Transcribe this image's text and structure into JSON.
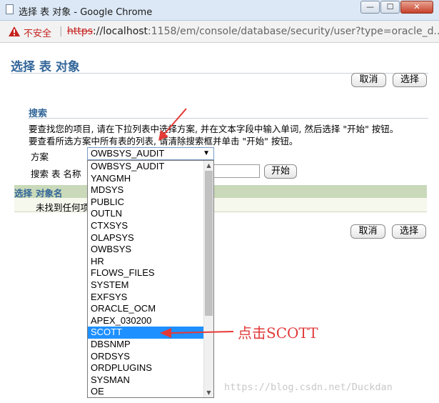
{
  "window": {
    "title": "选择 表 对象 - Google Chrome",
    "controls": {
      "minimize": "—",
      "maximize": "☐",
      "close": "✕"
    }
  },
  "address_bar": {
    "security_label": "不安全",
    "separator": "|",
    "url_scheme": "https",
    "url_host": "://localhost",
    "url_path": ":1158/em/console/database/security/user?type=oracle_d..."
  },
  "page": {
    "title": "选择 表 对象",
    "cancel_label": "取消",
    "select_label": "选择",
    "search": {
      "heading": "搜索",
      "instruction_1": "要查找您的项目, 请在下拉列表中选择方案, 并在文本字段中输入单词, 然后选择 \"开始\" 按钮。",
      "instruction_2": "要查看所选方案中所有表的列表, 请清除搜索框并单击 \"开始\" 按钮。",
      "schema_label": "方案",
      "schema_value": "OWBSYS_AUDIT",
      "search_label": "搜索 表 名称",
      "search_value": "",
      "go_label": "开始"
    },
    "table": {
      "columns": [
        "选择",
        "对象名"
      ],
      "empty_message": "未找到任何项"
    }
  },
  "dropdown": {
    "options": [
      "OWBSYS_AUDIT",
      "YANGMH",
      "MDSYS",
      "PUBLIC",
      "OUTLN",
      "CTXSYS",
      "OLAPSYS",
      "OWBSYS",
      "HR",
      "FLOWS_FILES",
      "SYSTEM",
      "EXFSYS",
      "ORACLE_OCM",
      "APEX_030200",
      "SCOTT",
      "DBSNMP",
      "ORDSYS",
      "ORDPLUGINS",
      "SYSMAN",
      "OE"
    ],
    "highlighted": "SCOTT"
  },
  "annotation": {
    "text": "点击SCOTT",
    "color": "#e03a3a"
  },
  "watermark": "https://blog.csdn.net/Duckdan",
  "colors": {
    "heading": "#336699",
    "table_header": "#c9d9b9",
    "selection": "#1e90ff",
    "insecure": "#c5221f"
  }
}
